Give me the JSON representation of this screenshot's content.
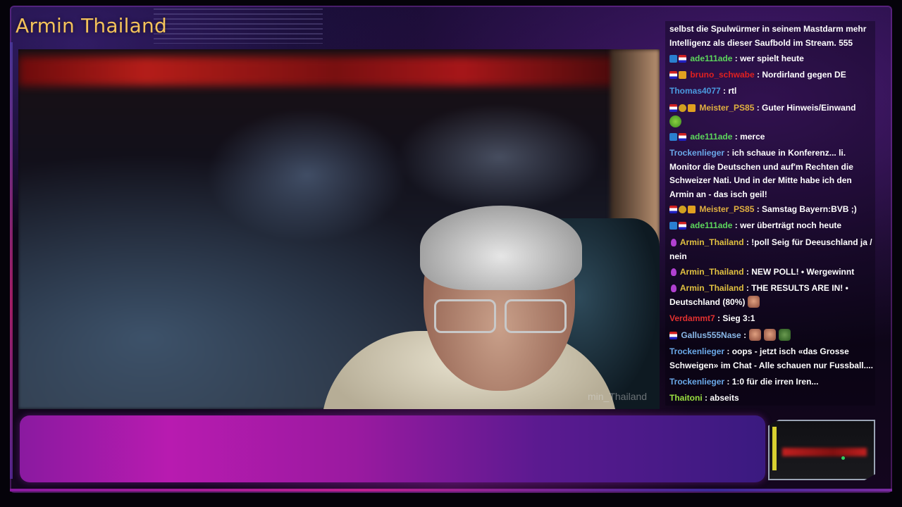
{
  "channel": {
    "title": "Armin Thailand",
    "title_color": "#f3c25a"
  },
  "webcam": {
    "watermark": "min_Thailand"
  },
  "chat": {
    "messages": [
      {
        "user": "",
        "user_color": "",
        "badges": [],
        "text": "selbst die Spulwürmer in seinem Mastdarm mehr Intelligenz als dieser Saufbold im Stream. 555",
        "emotes": []
      },
      {
        "user": "ade111ade",
        "user_color": "#5cd65c",
        "badges": [
          "prime",
          "flag"
        ],
        "text": ": wer spielt heute",
        "emotes": []
      },
      {
        "user": "bruno_schwabe",
        "user_color": "#e02020",
        "badges": [
          "flag",
          "crown"
        ],
        "text": ": Nordirland gegen DE",
        "emotes": []
      },
      {
        "user": "Thomas4077",
        "user_color": "#4a9adf",
        "badges": [],
        "text": ": rtl",
        "emotes": []
      },
      {
        "user": "Meister_PS85",
        "user_color": "#e0b040",
        "badges": [
          "flag",
          "info",
          "crown"
        ],
        "text": ": Guter Hinweis/Einwand",
        "emotes": [
          "green"
        ]
      },
      {
        "user": "ade111ade",
        "user_color": "#5cd65c",
        "badges": [
          "prime",
          "flag"
        ],
        "text": ": merce",
        "emotes": []
      },
      {
        "user": "Trockenlieger",
        "user_color": "#6aa8e8",
        "badges": [],
        "text": ": ich schaue in Konferenz... li. Monitor die Deutschen und auf'm Rechten die Schweizer Nati. Und in der Mitte habe ich den Armin an - das isch geil!",
        "emotes": []
      },
      {
        "user": "Meister_PS85",
        "user_color": "#e0b040",
        "badges": [
          "flag",
          "info",
          "crown"
        ],
        "text": ": Samstag Bayern:BVB ;)",
        "emotes": []
      },
      {
        "user": "ade111ade",
        "user_color": "#5cd65c",
        "badges": [
          "prime",
          "flag"
        ],
        "text": ": wer überträgt noch heute",
        "emotes": []
      },
      {
        "user": "Armin_Thailand",
        "user_color": "#e0c040",
        "badges": [
          "mic"
        ],
        "text": ": !poll Seig für Deeuschland ja / nein",
        "emotes": []
      },
      {
        "user": "Armin_Thailand",
        "user_color": "#e0c040",
        "badges": [
          "mic"
        ],
        "text": ": NEW POLL! • Wergewinnt",
        "emotes": []
      },
      {
        "user": "Armin_Thailand",
        "user_color": "#e0c040",
        "badges": [
          "mic"
        ],
        "text": ": THE RESULTS ARE IN! • Deutschland (80%)",
        "emotes": [
          "face"
        ]
      },
      {
        "user": "Verdammt7",
        "user_color": "#e03030",
        "badges": [],
        "text": ": Sieg 3:1",
        "emotes": []
      },
      {
        "user": "Gallus555Nase",
        "user_color": "#8ab8e8",
        "badges": [
          "flag"
        ],
        "text": ":",
        "emotes": [
          "face",
          "face",
          "frog"
        ]
      },
      {
        "user": "Trockenlieger",
        "user_color": "#6aa8e8",
        "badges": [],
        "text": ": oops - jetzt isch «das Grosse Schweigen» im Chat - Alle schauen nur Fussball....",
        "emotes": []
      },
      {
        "user": "Trockenlieger",
        "user_color": "#6aa8e8",
        "badges": [],
        "text": ": 1:0 für die irren Iren...",
        "emotes": []
      },
      {
        "user": "Thaitoni",
        "user_color": "#9ae040",
        "badges": [],
        "text": ": abseits",
        "emotes": []
      }
    ]
  }
}
